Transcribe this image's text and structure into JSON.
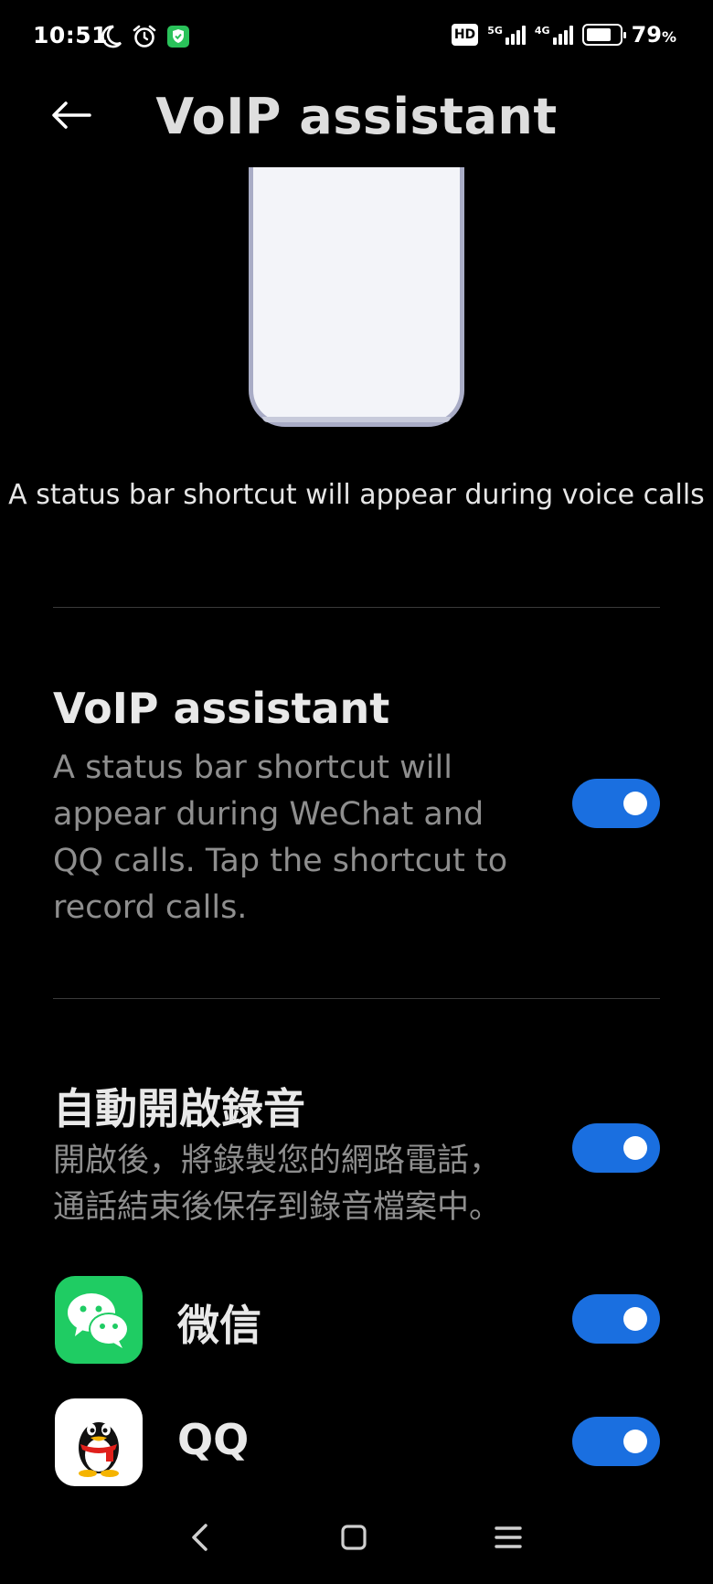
{
  "status_bar": {
    "time": "10:51",
    "hd_badge": "HD",
    "net1": "5G",
    "net2": "4G",
    "battery_percent": "79",
    "battery_suffix": "%",
    "battery_level": 0.79,
    "icons": [
      "moon-icon",
      "alarm-icon",
      "shield-check-icon",
      "signal-icon",
      "battery-icon"
    ]
  },
  "header": {
    "title": "VoIP assistant",
    "back_icon": "arrow-left-icon"
  },
  "illustration": {
    "caption": "A status bar shortcut will appear during voice calls"
  },
  "voip_section": {
    "title": "VoIP assistant",
    "desc_lines": [
      "A status bar shortcut will",
      "appear during WeChat and",
      "QQ calls. Tap the shortcut to",
      "record calls."
    ],
    "toggle_on": true
  },
  "auto_record_section": {
    "title": "自動開啟錄音",
    "desc_lines": [
      "開啟後，將錄製您的網路電話，",
      "通話結束後保存到錄音檔案中。"
    ],
    "toggle_on": true
  },
  "apps": [
    {
      "name": "微信",
      "icon": "wechat-icon",
      "enabled": true
    },
    {
      "name": "QQ",
      "icon": "qq-penguin-icon",
      "enabled": true
    }
  ],
  "colors": {
    "toggle_on": "#1a6fe0",
    "wechat_green": "#1fcc63",
    "background": "#000000"
  },
  "nav": [
    "back-nav-icon",
    "home-nav-icon",
    "menu-nav-icon"
  ]
}
